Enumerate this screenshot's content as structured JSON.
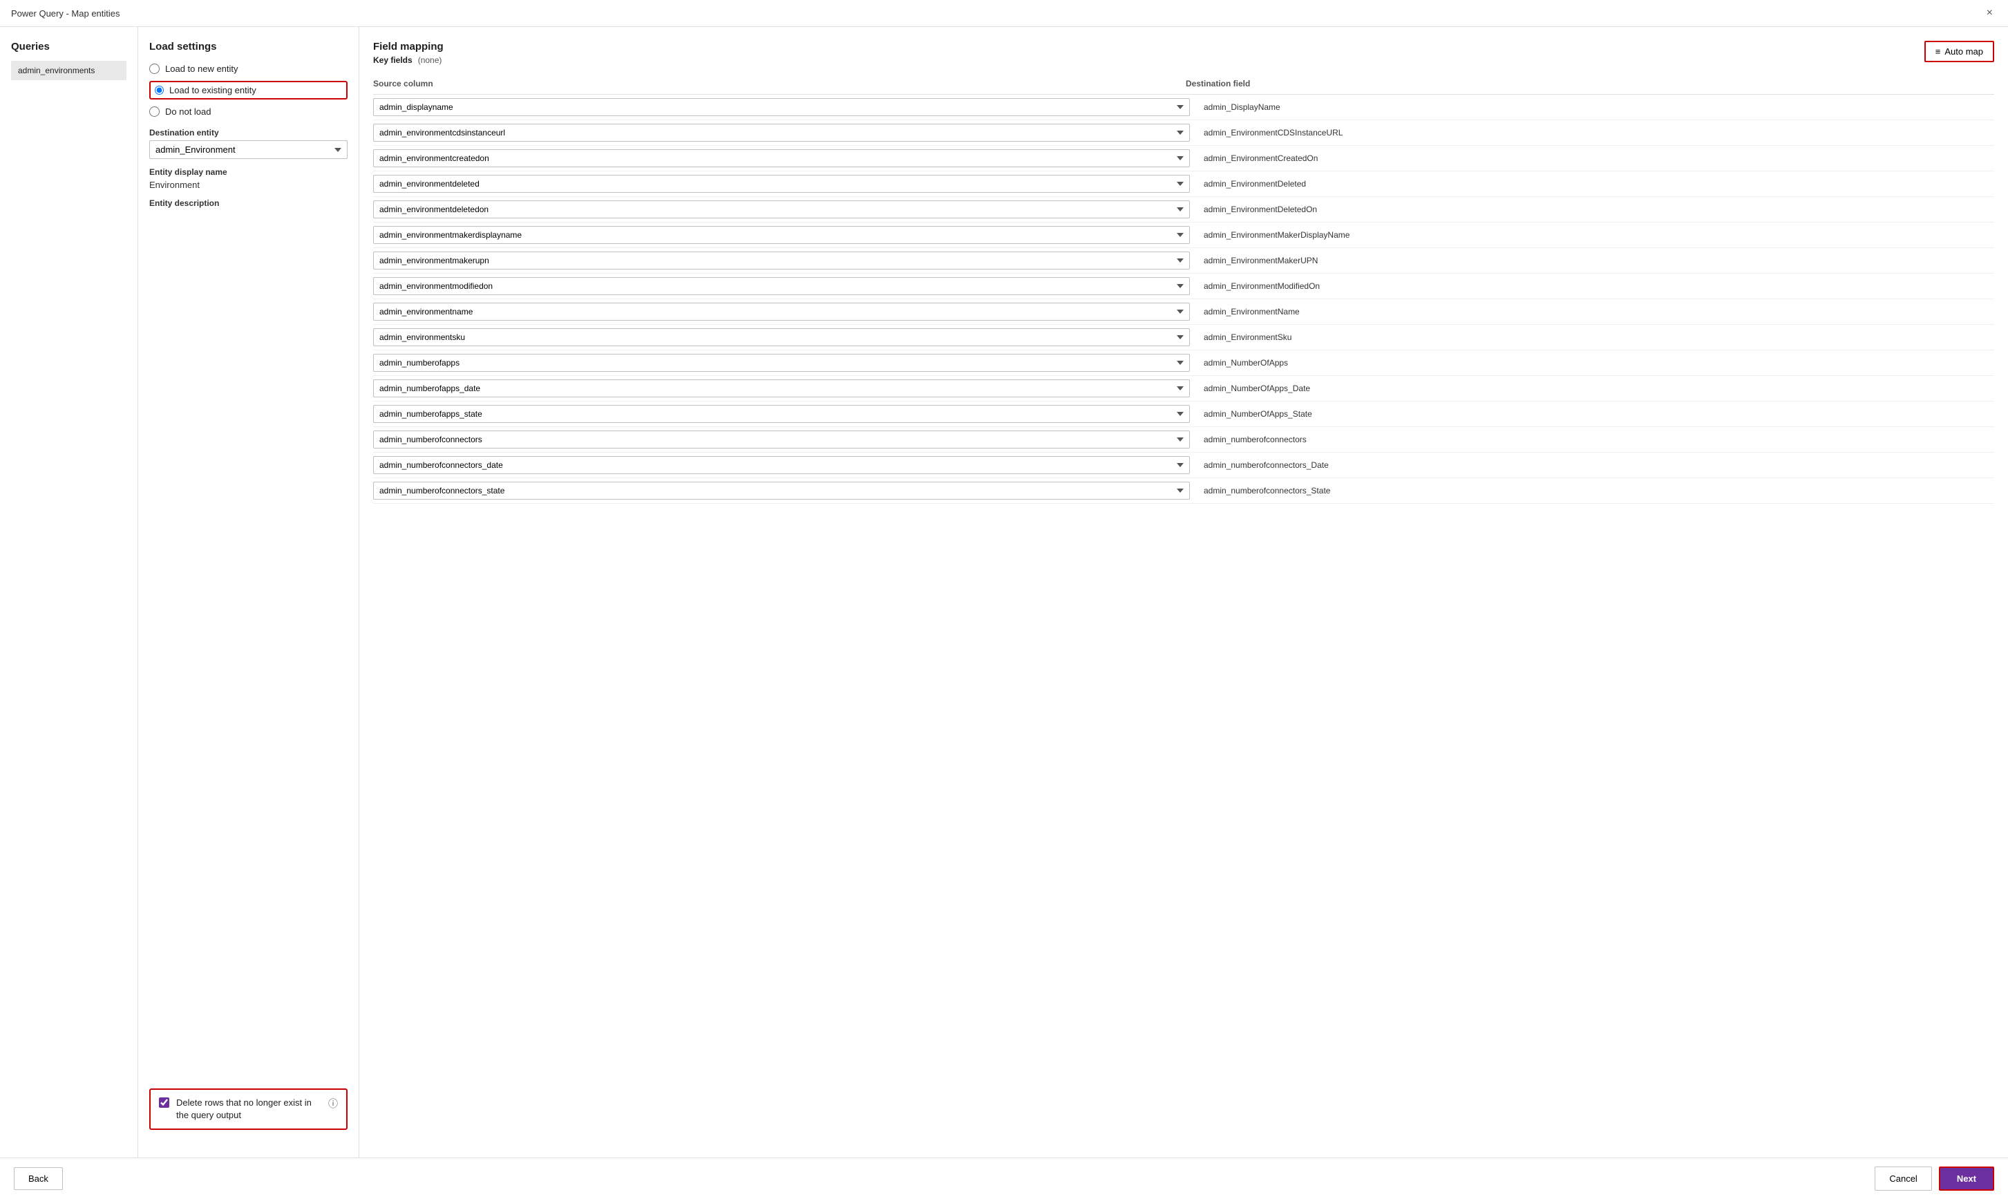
{
  "titleBar": {
    "title": "Power Query - Map entities",
    "closeLabel": "×"
  },
  "queries": {
    "heading": "Queries",
    "items": [
      {
        "label": "admin_environments"
      }
    ]
  },
  "loadSettings": {
    "heading": "Load settings",
    "options": [
      {
        "id": "load-new",
        "label": "Load to new entity",
        "checked": false
      },
      {
        "id": "load-existing",
        "label": "Load to existing entity",
        "checked": true
      },
      {
        "id": "do-not-load",
        "label": "Do not load",
        "checked": false
      }
    ],
    "destinationEntityLabel": "Destination entity",
    "destinationEntityValue": "admin_Environment",
    "entityDisplayNameLabel": "Entity display name",
    "entityDisplayNameValue": "Environment",
    "entityDescriptionLabel": "Entity description",
    "checkboxLabel": "Delete rows that no longer exist in the query output",
    "checkboxChecked": true,
    "infoIcon": "ⓘ"
  },
  "fieldMapping": {
    "heading": "Field mapping",
    "keyFieldsLabel": "Key fields",
    "keyFieldsValue": "(none)",
    "autoMapLabel": "Auto map",
    "sourceColumnHeader": "Source column",
    "destinationFieldHeader": "Destination field",
    "rows": [
      {
        "source": "admin_displayname",
        "destination": "admin_DisplayName"
      },
      {
        "source": "admin_environmentcdsinstanceurl",
        "destination": "admin_EnvironmentCDSInstanceURL"
      },
      {
        "source": "admin_environmentcreatedon",
        "destination": "admin_EnvironmentCreatedOn"
      },
      {
        "source": "admin_environmentdeleted",
        "destination": "admin_EnvironmentDeleted"
      },
      {
        "source": "admin_environmentdeletedon",
        "destination": "admin_EnvironmentDeletedOn"
      },
      {
        "source": "admin_environmentmakerdisplayname",
        "destination": "admin_EnvironmentMakerDisplayName"
      },
      {
        "source": "admin_environmentmakerupn",
        "destination": "admin_EnvironmentMakerUPN"
      },
      {
        "source": "admin_environmentmodifiedon",
        "destination": "admin_EnvironmentModifiedOn"
      },
      {
        "source": "admin_environmentname",
        "destination": "admin_EnvironmentName"
      },
      {
        "source": "admin_environmentsku",
        "destination": "admin_EnvironmentSku"
      },
      {
        "source": "admin_numberofapps",
        "destination": "admin_NumberOfApps"
      },
      {
        "source": "admin_numberofapps_date",
        "destination": "admin_NumberOfApps_Date"
      },
      {
        "source": "admin_numberofapps_state",
        "destination": "admin_NumberOfApps_State"
      },
      {
        "source": "admin_numberofconnectors",
        "destination": "admin_numberofconnectors"
      },
      {
        "source": "admin_numberofconnectors_date",
        "destination": "admin_numberofconnectors_Date"
      },
      {
        "source": "admin_numberofconnectors_state",
        "destination": "admin_numberofconnectors_State"
      }
    ]
  },
  "footer": {
    "backLabel": "Back",
    "cancelLabel": "Cancel",
    "nextLabel": "Next"
  }
}
